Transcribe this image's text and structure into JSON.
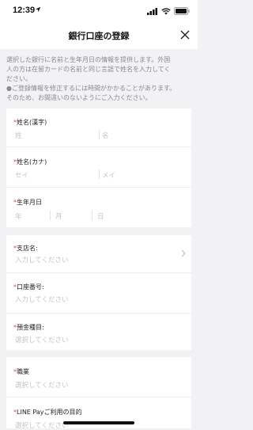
{
  "status": {
    "time": "12:39"
  },
  "header": {
    "title": "銀行口座の登録"
  },
  "notice": {
    "lines": [
      "選択した銀行に名前と生年月日の情報を提供します。外国",
      "人の方は在留カードの名前と同じ言語で姓名を入力してく",
      "ださい。",
      "●ご登録情報を修正するには時間がかかることがあります。",
      "そのため、お間違いのないようにご入力ください。"
    ]
  },
  "form": {
    "required_mark": "*",
    "name_kanji": {
      "label": "姓名(漢字)",
      "last_placeholder": "姓",
      "first_placeholder": "名"
    },
    "name_kana": {
      "label": "姓名(カナ)",
      "last_placeholder": "セイ",
      "first_placeholder": "メイ"
    },
    "birthdate": {
      "label": "生年月日",
      "year": "年",
      "month": "月",
      "day": "日"
    },
    "branch": {
      "label": "支店名:",
      "placeholder": "入力してください"
    },
    "account_number": {
      "label": "口座番号:",
      "placeholder": "入力してください"
    },
    "deposit_type": {
      "label": "預金種目:",
      "placeholder": "選択してください"
    },
    "occupation": {
      "label": "職業",
      "placeholder": "選択してください"
    },
    "purpose": {
      "label": "LINE Payご利用の目的",
      "placeholder": "選択してください"
    }
  }
}
